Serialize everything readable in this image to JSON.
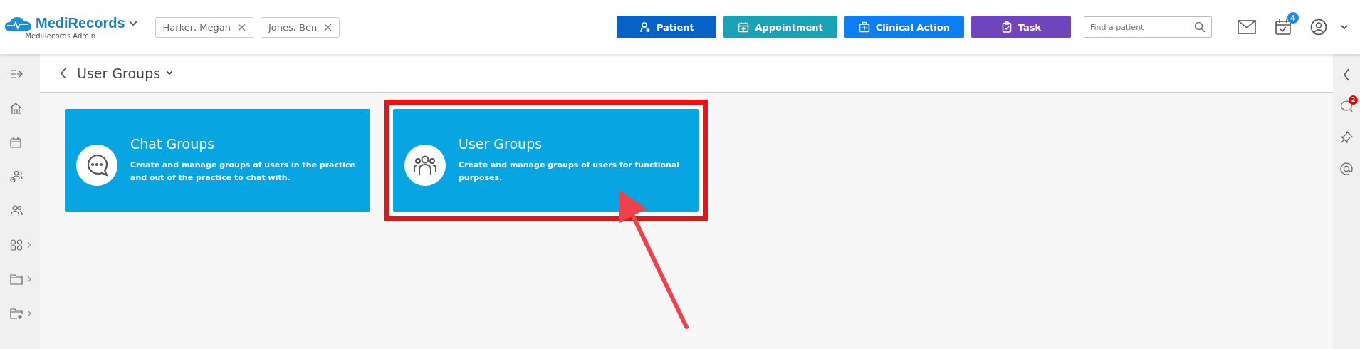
{
  "header": {
    "logo": "MediRecords",
    "account": "MediRecords Admin",
    "patient_tabs": [
      {
        "name": "Harker, Megan"
      },
      {
        "name": "Jones, Ben"
      }
    ],
    "actions": [
      {
        "kind": "patient",
        "label": "Patient"
      },
      {
        "kind": "appointment",
        "label": "Appointment"
      },
      {
        "kind": "clinical",
        "label": "Clinical Action"
      },
      {
        "kind": "task",
        "label": "Task"
      }
    ],
    "search": {
      "placeholder": "Find a patient"
    },
    "calendar_badge": "4"
  },
  "sidebar": {
    "items": [
      {
        "kind": "expand",
        "has_submenu": false
      },
      {
        "kind": "home",
        "has_submenu": false
      },
      {
        "kind": "calendar",
        "has_submenu": false
      },
      {
        "kind": "patients",
        "has_submenu": false
      },
      {
        "kind": "users",
        "has_submenu": false
      },
      {
        "kind": "apps",
        "has_submenu": true
      },
      {
        "kind": "folder",
        "has_submenu": true
      },
      {
        "kind": "folder-add",
        "has_submenu": true
      }
    ]
  },
  "page": {
    "title": "User Groups",
    "cards": [
      {
        "kind": "chat",
        "title": "Chat Groups",
        "description": "Create and manage groups of users in the practice and out of the practice to chat with.",
        "highlighted": false
      },
      {
        "kind": "users",
        "title": "User Groups",
        "description": "Create and manage groups of users for functional purposes.",
        "highlighted": true
      }
    ]
  },
  "right_panel": {
    "chat_badge": "2"
  }
}
